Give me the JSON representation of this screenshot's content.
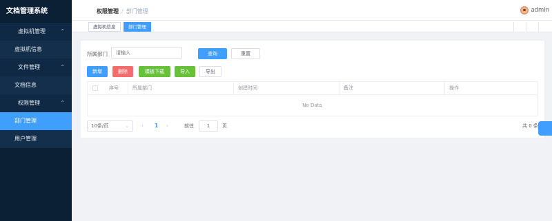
{
  "sidebar": {
    "title": "文档管理系统",
    "groups": [
      {
        "label": "虚拟机管理",
        "items": [
          "虚拟机信息"
        ]
      },
      {
        "label": "文件管理",
        "items": [
          "文档信息"
        ]
      },
      {
        "label": "权限管理",
        "items": [
          "部门管理",
          "用户管理"
        ]
      }
    ],
    "active_item": "部门管理",
    "chevron": "chevron-up-icon"
  },
  "header": {
    "breadcrumb": [
      "权限管理",
      "部门管理"
    ],
    "separator": "/",
    "username": "admin",
    "avatar_icon": "avatar-icon"
  },
  "tags": [
    "虚拟机信息",
    "部门管理"
  ],
  "active_tag": "部门管理",
  "filter": {
    "label": "所属部门",
    "placeholder": "请输入",
    "query_label": "查询",
    "reset_label": "重置"
  },
  "toolbar": {
    "add_label": "新增",
    "delete_label": "删除",
    "template_label": "模板下载",
    "import_label": "导入",
    "export_label": "导出"
  },
  "table": {
    "columns": [
      "序号",
      "所属部门",
      "创建时间",
      "备注",
      "操作"
    ],
    "empty_text": "No Data"
  },
  "pagination": {
    "page_size": "10条/页",
    "current_page": "1",
    "goto_prefix": "前往",
    "goto_value": "1",
    "goto_suffix": "页",
    "total_text": "共 0 条"
  },
  "colors": {
    "sidebar_bg": "#0b2035",
    "primary": "#409eff",
    "danger": "#f56c6c",
    "success": "#67c23a"
  }
}
